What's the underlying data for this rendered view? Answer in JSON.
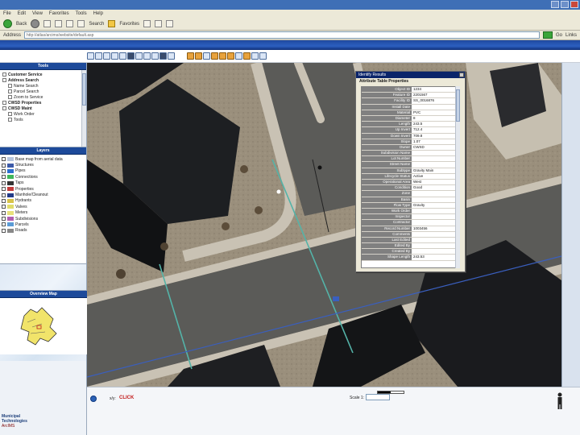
{
  "window": {
    "title": ""
  },
  "menu": {
    "items": [
      "File",
      "Edit",
      "View",
      "Favorites",
      "Tools",
      "Help"
    ]
  },
  "nav": {
    "back_label": "Back",
    "search_label": "Search",
    "favorites_label": "Favorites"
  },
  "address": {
    "label": "Address",
    "value": "http://atlas/arcims/website/default.asp",
    "go_label": "Go",
    "links_label": "Links"
  },
  "panels": {
    "tools_title": "Tools",
    "layers_title": "Layers",
    "overview_title": "Overview Map"
  },
  "tools_tree": [
    {
      "label": "Customer Service",
      "level": 0,
      "bold": true
    },
    {
      "label": "Address Search",
      "level": 0,
      "bold": true
    },
    {
      "label": "Name Search",
      "level": 1,
      "bold": false
    },
    {
      "label": "Parcel Search",
      "level": 1,
      "bold": false
    },
    {
      "label": "Zoom to Service",
      "level": 1,
      "bold": false
    },
    {
      "label": "CWSD Properties",
      "level": 0,
      "bold": true
    },
    {
      "label": "CWSD Maint",
      "level": 0,
      "bold": true
    },
    {
      "label": "Work Order",
      "level": 1,
      "bold": false
    },
    {
      "label": "Tools",
      "level": 1,
      "bold": false
    }
  ],
  "layers": [
    {
      "label": "Base map from aerial data",
      "color": "#b7c6de"
    },
    {
      "label": "Structures",
      "color": "#3c5aa8"
    },
    {
      "label": "Pipes",
      "color": "#2d6fd0"
    },
    {
      "label": "Connections",
      "color": "#3fb65a"
    },
    {
      "label": "Taps",
      "color": "#333333"
    },
    {
      "label": "Properties",
      "color": "#c23b3b"
    },
    {
      "label": "Manhole/Cleanout",
      "color": "#223a88"
    },
    {
      "label": "Hydrants",
      "color": "#d8c34a"
    },
    {
      "label": "Valves",
      "color": "#e0dc6a"
    },
    {
      "label": "Meters",
      "color": "#e8e07a"
    },
    {
      "label": "Subdivisions",
      "color": "#b05fb0"
    },
    {
      "label": "Parcels",
      "color": "#5a9bd6"
    },
    {
      "label": "Roads",
      "color": "#888888"
    }
  ],
  "identify": {
    "window_title": "Identify Results",
    "header": "Attribute Table Properties",
    "rows": [
      {
        "key": "Object ID",
        "value": "1234"
      },
      {
        "key": "Feature ID",
        "value": "2201567"
      },
      {
        "key": "Facility ID",
        "value": "SS_0016876"
      },
      {
        "key": "Install Date",
        "value": ""
      },
      {
        "key": "Material",
        "value": "PVC"
      },
      {
        "key": "Diameter",
        "value": "8"
      },
      {
        "key": "Length",
        "value": "243.5"
      },
      {
        "key": "Up Invert",
        "value": "712.4"
      },
      {
        "key": "Down Invert",
        "value": "709.8"
      },
      {
        "key": "Slope",
        "value": "1.07"
      },
      {
        "key": "Owner",
        "value": "CWSD"
      },
      {
        "key": "Subdivision Name",
        "value": ""
      },
      {
        "key": "Lot Number",
        "value": ""
      },
      {
        "key": "Street Name",
        "value": ""
      },
      {
        "key": "Subtype",
        "value": "Gravity Main"
      },
      {
        "key": "Lifecycle Status",
        "value": "Active"
      },
      {
        "key": "Operational Area",
        "value": "West"
      },
      {
        "key": "Condition",
        "value": "Good"
      },
      {
        "key": "Zone",
        "value": ""
      },
      {
        "key": "Basin",
        "value": ""
      },
      {
        "key": "Flow Type",
        "value": "Gravity"
      },
      {
        "key": "Work Order",
        "value": ""
      },
      {
        "key": "Inspector",
        "value": ""
      },
      {
        "key": "Contractor",
        "value": ""
      },
      {
        "key": "Record Number",
        "value": "1003456"
      },
      {
        "key": "Comments",
        "value": ""
      },
      {
        "key": "Last Edited",
        "value": ""
      },
      {
        "key": "Edited By",
        "value": ""
      },
      {
        "key": "Created By",
        "value": ""
      },
      {
        "key": "Shape Length",
        "value": "243.53"
      }
    ]
  },
  "status": {
    "coord_label": "x/y:",
    "coord_value": "CLICK",
    "scale_label": "Scale 1:",
    "logo_line1": "Municipal",
    "logo_line2": "Technologies",
    "logo_line3": "ArcIMS"
  },
  "colors": {
    "accent": "#1d4a9a",
    "titlebar": "#3f6fb6",
    "coord_red": "#c21c1c"
  }
}
